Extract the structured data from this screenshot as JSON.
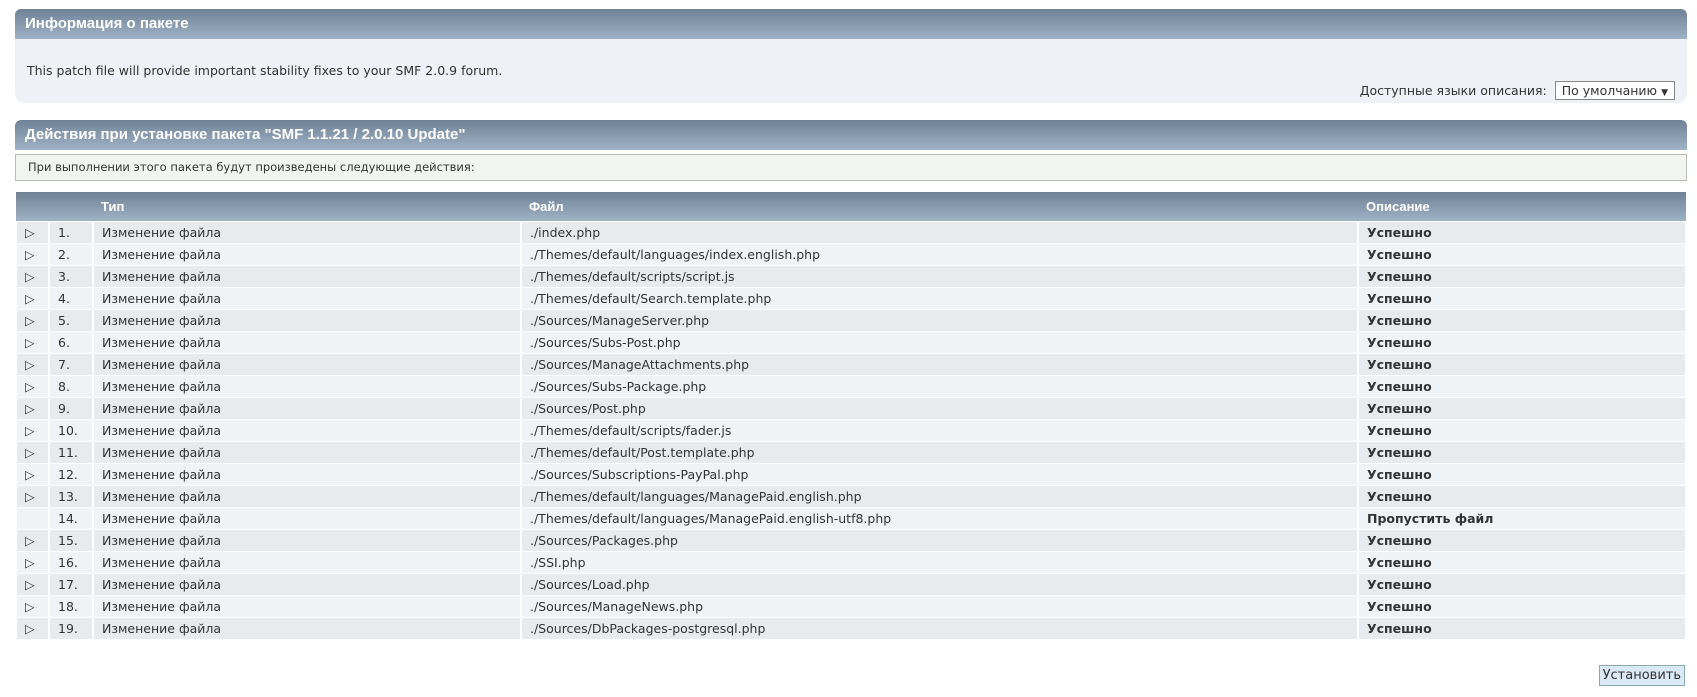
{
  "info": {
    "title": "Информация о пакете",
    "description": "This patch file will provide important stability fixes to your SMF 2.0.9 forum.",
    "lang_label": "Доступные языки описания:",
    "lang_value": "По умолчанию"
  },
  "actions": {
    "title": "Действия при установке пакета \"SMF 1.1.21 / 2.0.10 Update\"",
    "notice": "При выполнении этого пакета будут произведены следующие действия:",
    "columns": [
      "Тип",
      "Файл",
      "Описание"
    ],
    "rows": [
      {
        "num": "1.",
        "type": "Изменение файла",
        "file": "./index.php",
        "desc": "Успешно",
        "expand": true
      },
      {
        "num": "2.",
        "type": "Изменение файла",
        "file": "./Themes/default/languages/index.english.php",
        "desc": "Успешно",
        "expand": true
      },
      {
        "num": "3.",
        "type": "Изменение файла",
        "file": "./Themes/default/scripts/script.js",
        "desc": "Успешно",
        "expand": true
      },
      {
        "num": "4.",
        "type": "Изменение файла",
        "file": "./Themes/default/Search.template.php",
        "desc": "Успешно",
        "expand": true
      },
      {
        "num": "5.",
        "type": "Изменение файла",
        "file": "./Sources/ManageServer.php",
        "desc": "Успешно",
        "expand": true
      },
      {
        "num": "6.",
        "type": "Изменение файла",
        "file": "./Sources/Subs-Post.php",
        "desc": "Успешно",
        "expand": true
      },
      {
        "num": "7.",
        "type": "Изменение файла",
        "file": "./Sources/ManageAttachments.php",
        "desc": "Успешно",
        "expand": true
      },
      {
        "num": "8.",
        "type": "Изменение файла",
        "file": "./Sources/Subs-Package.php",
        "desc": "Успешно",
        "expand": true
      },
      {
        "num": "9.",
        "type": "Изменение файла",
        "file": "./Sources/Post.php",
        "desc": "Успешно",
        "expand": true
      },
      {
        "num": "10.",
        "type": "Изменение файла",
        "file": "./Themes/default/scripts/fader.js",
        "desc": "Успешно",
        "expand": true
      },
      {
        "num": "11.",
        "type": "Изменение файла",
        "file": "./Themes/default/Post.template.php",
        "desc": "Успешно",
        "expand": true
      },
      {
        "num": "12.",
        "type": "Изменение файла",
        "file": "./Sources/Subscriptions-PayPal.php",
        "desc": "Успешно",
        "expand": true
      },
      {
        "num": "13.",
        "type": "Изменение файла",
        "file": "./Themes/default/languages/ManagePaid.english.php",
        "desc": "Успешно",
        "expand": true
      },
      {
        "num": "14.",
        "type": "Изменение файла",
        "file": "./Themes/default/languages/ManagePaid.english-utf8.php",
        "desc": "Пропустить файл",
        "expand": false
      },
      {
        "num": "15.",
        "type": "Изменение файла",
        "file": "./Sources/Packages.php",
        "desc": "Успешно",
        "expand": true
      },
      {
        "num": "16.",
        "type": "Изменение файла",
        "file": "./SSI.php",
        "desc": "Успешно",
        "expand": true
      },
      {
        "num": "17.",
        "type": "Изменение файла",
        "file": "./Sources/Load.php",
        "desc": "Успешно",
        "expand": true
      },
      {
        "num": "18.",
        "type": "Изменение файла",
        "file": "./Sources/ManageNews.php",
        "desc": "Успешно",
        "expand": true
      },
      {
        "num": "19.",
        "type": "Изменение файла",
        "file": "./Sources/DbPackages-postgresql.php",
        "desc": "Успешно",
        "expand": true
      }
    ]
  },
  "install_label": "Установить"
}
